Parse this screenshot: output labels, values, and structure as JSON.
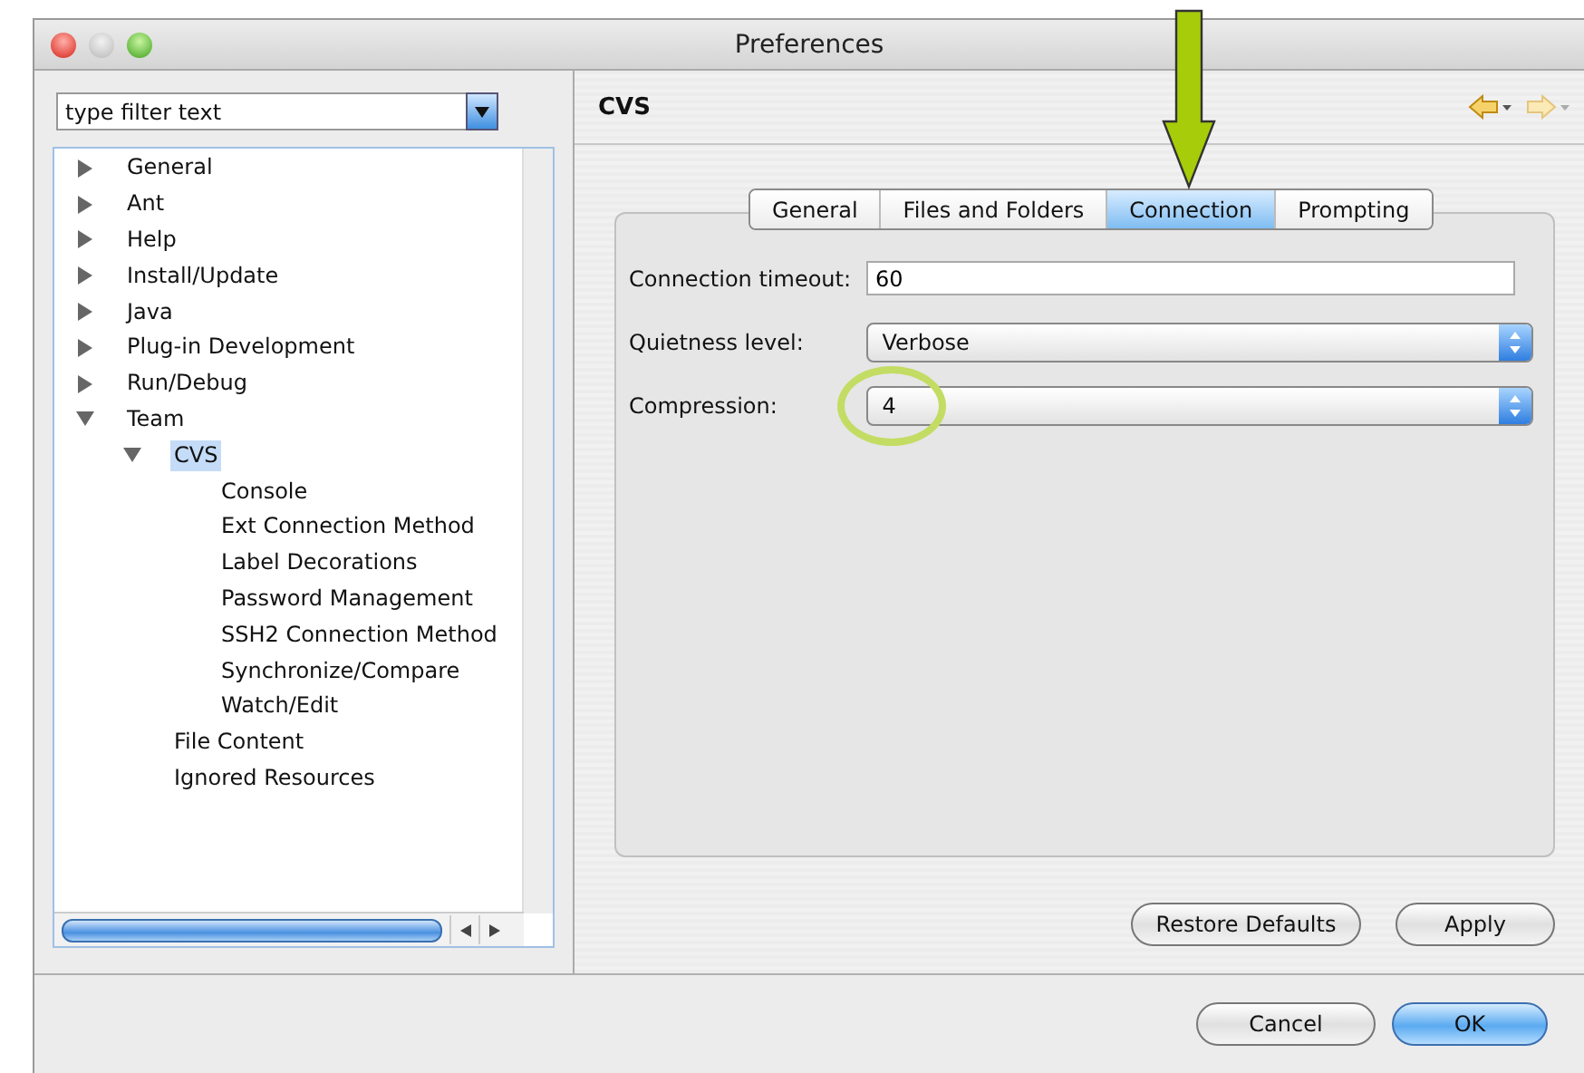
{
  "window": {
    "title": "Preferences"
  },
  "filter": {
    "placeholder": "type filter text"
  },
  "tree": [
    {
      "label": "General",
      "expanded": false,
      "selected": false
    },
    {
      "label": "Ant",
      "expanded": false,
      "selected": false
    },
    {
      "label": "Help",
      "expanded": false,
      "selected": false
    },
    {
      "label": "Install/Update",
      "expanded": false,
      "selected": false
    },
    {
      "label": "Java",
      "expanded": false,
      "selected": false
    },
    {
      "label": "Plug-in Development",
      "expanded": false,
      "selected": false
    },
    {
      "label": "Run/Debug",
      "expanded": false,
      "selected": false
    },
    {
      "label": "Team",
      "expanded": true,
      "selected": false,
      "children": [
        {
          "label": "CVS",
          "expanded": true,
          "selected": true,
          "children": [
            {
              "label": "Console",
              "selected": false
            },
            {
              "label": "Ext Connection Method",
              "selected": false
            },
            {
              "label": "Label Decorations",
              "selected": false
            },
            {
              "label": "Password Management",
              "selected": false
            },
            {
              "label": "SSH2 Connection Method",
              "selected": false
            },
            {
              "label": "Synchronize/Compare",
              "selected": false
            },
            {
              "label": "Watch/Edit",
              "selected": false
            }
          ]
        },
        {
          "label": "File Content",
          "selected": false
        },
        {
          "label": "Ignored Resources",
          "selected": false
        }
      ]
    }
  ],
  "page": {
    "title": "CVS"
  },
  "tabs": [
    {
      "label": "General",
      "selected": false
    },
    {
      "label": "Files and Folders",
      "selected": false
    },
    {
      "label": "Connection",
      "selected": true
    },
    {
      "label": "Prompting",
      "selected": false
    }
  ],
  "fields": [
    {
      "kind": "text",
      "label": "Connection timeout:",
      "value": "60"
    },
    {
      "kind": "select",
      "label": "Quietness level:",
      "value": "Verbose"
    },
    {
      "kind": "select",
      "label": "Compression:",
      "value": "4"
    }
  ],
  "panel_buttons": [
    "Restore Defaults",
    "Apply"
  ],
  "dialog_buttons": [
    {
      "label": "Cancel",
      "default": false
    },
    {
      "label": "OK",
      "default": true
    }
  ]
}
